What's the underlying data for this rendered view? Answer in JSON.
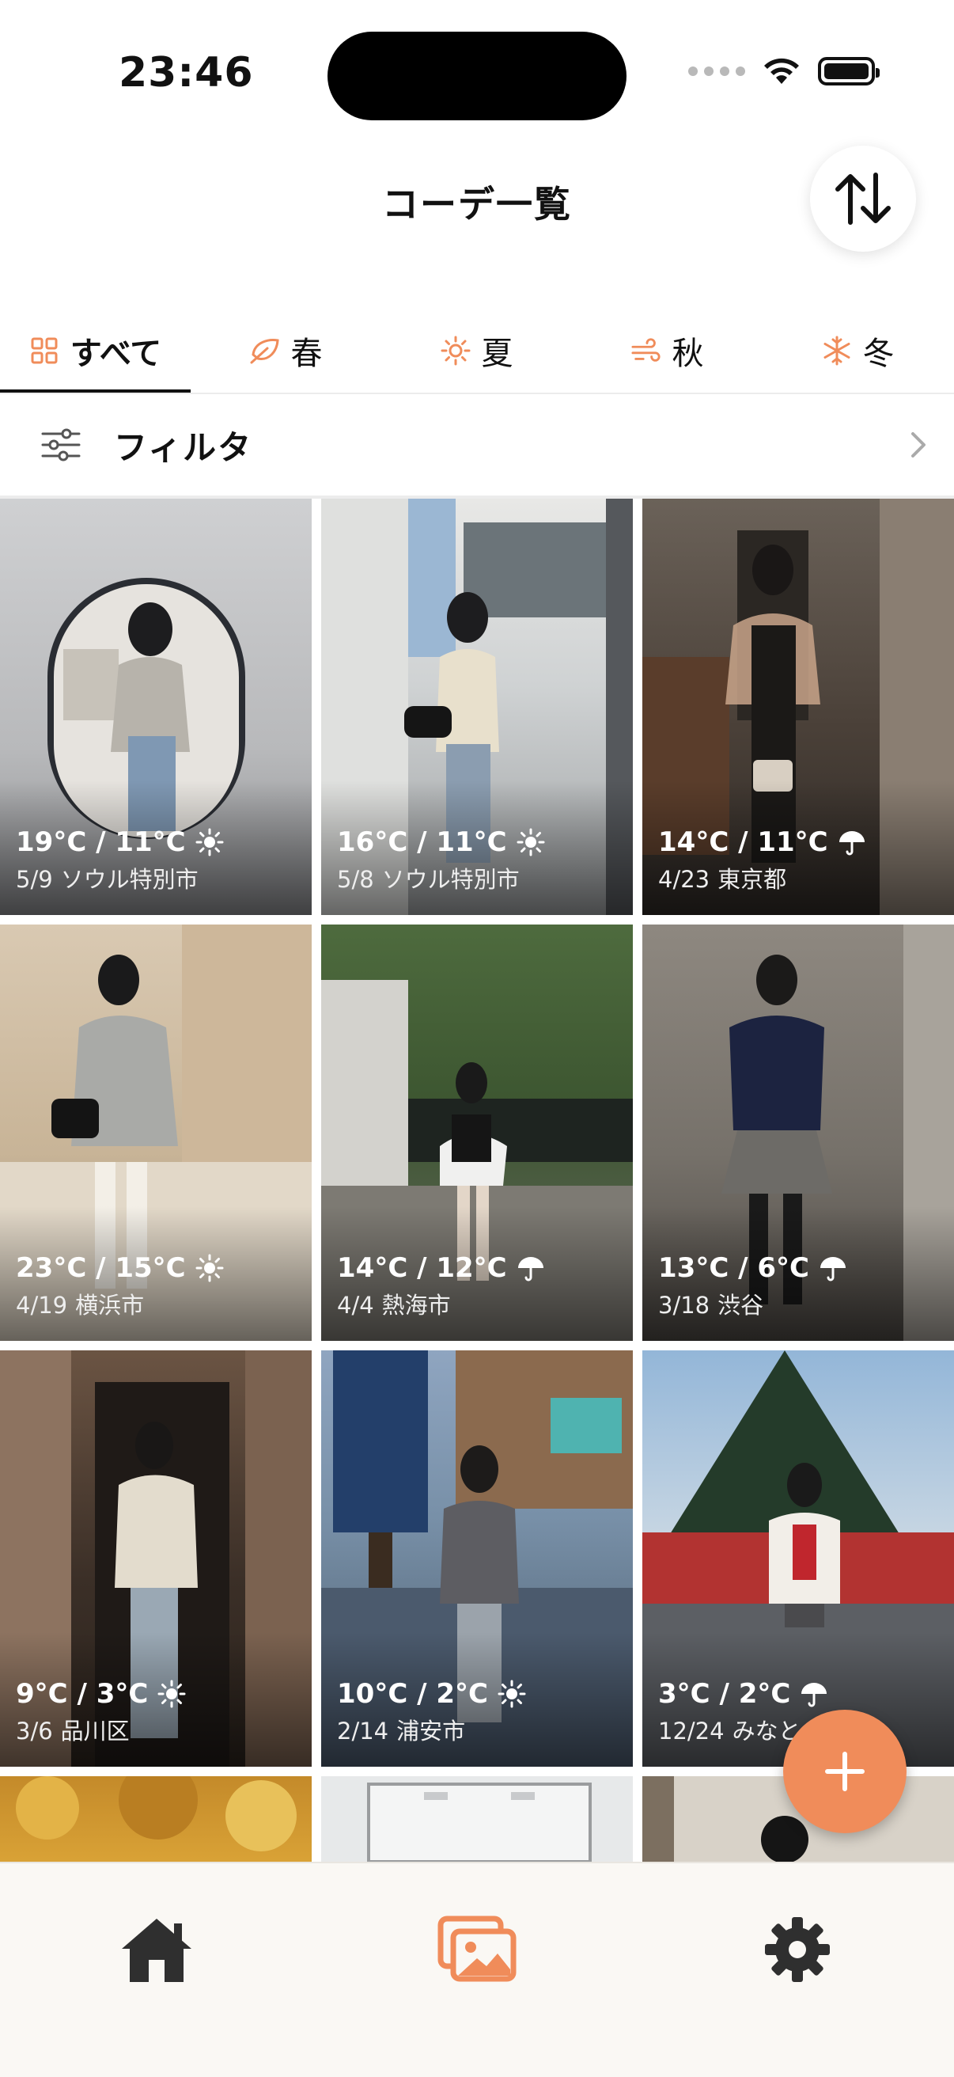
{
  "status_bar": {
    "time": "23:46"
  },
  "header": {
    "title": "コーデ一覧"
  },
  "tabs": [
    {
      "label": "すべて",
      "icon": "grid-icon",
      "active": true
    },
    {
      "label": "春",
      "icon": "leaf-icon"
    },
    {
      "label": "夏",
      "icon": "sun-icon"
    },
    {
      "label": "秋",
      "icon": "wind-icon"
    },
    {
      "label": "冬",
      "icon": "snowflake-icon"
    }
  ],
  "filter": {
    "label": "フィルタ"
  },
  "outfits": [
    {
      "temp": "19°C / 11°C",
      "weather": "sunny",
      "date": "5/9",
      "place": "ソウル特別市"
    },
    {
      "temp": "16°C / 11°C",
      "weather": "sunny",
      "date": "5/8",
      "place": "ソウル特別市"
    },
    {
      "temp": "14°C / 11°C",
      "weather": "rain",
      "date": "4/23",
      "place": "東京都"
    },
    {
      "temp": "23°C / 15°C",
      "weather": "sunny",
      "date": "4/19",
      "place": "横浜市"
    },
    {
      "temp": "14°C / 12°C",
      "weather": "rain",
      "date": "4/4",
      "place": "熱海市"
    },
    {
      "temp": "13°C / 6°C",
      "weather": "rain",
      "date": "3/18",
      "place": "渋谷"
    },
    {
      "temp": "9°C / 3°C",
      "weather": "sunny",
      "date": "3/6",
      "place": "品川区"
    },
    {
      "temp": "10°C / 2°C",
      "weather": "sunny",
      "date": "2/14",
      "place": "浦安市"
    },
    {
      "temp": "3°C / 2°C",
      "weather": "rain",
      "date": "12/24",
      "place": "みなと"
    }
  ],
  "colors": {
    "accent": "#f08c5a",
    "nav_bg": "#faf8f4"
  },
  "bottom_nav": [
    {
      "name": "home-icon",
      "active": false
    },
    {
      "name": "gallery-icon",
      "active": true
    },
    {
      "name": "settings-icon",
      "active": false
    }
  ]
}
